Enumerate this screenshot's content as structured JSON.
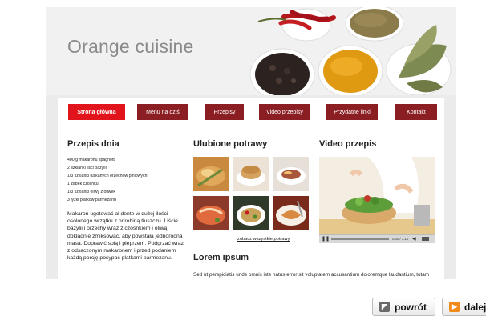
{
  "site": {
    "brand": "Orange cuisine",
    "nav": [
      "Strona główna",
      "Menu na dziś",
      "Przepisy",
      "Video przepisy",
      "Przydatne linki",
      "Kontakt"
    ]
  },
  "recipe": {
    "title": "Przepis dnia",
    "ingredients": [
      "400 g makaronu spaghetti",
      "2 szklanki liści bazylii",
      "1/3 szklanki łuskanych orzechów piniowych",
      "1 ząbek czosnku",
      "1/3 szklanki oliwy z oliwek",
      "3 łyżki płatków parmezanu"
    ],
    "description": "Makaron ugotować al dente w dużej ilości osolonego wrzątku z odrobiną tłuszczu. Liście bazylii i orzechy wraz z czosnkiem i oliwą dokładnie zmiksować, aby powstała jednorodna masa. Doprawić solą i pieprzem. Podgrzać wraz z odsączonym makaronem i przed podaniem każdą porcję posypać płatkami parmezanu."
  },
  "favorites": {
    "title": "Ulubione potrawy",
    "link": "zobacz wszystkie potrawy"
  },
  "video": {
    "title": "Video przepis",
    "time": "0:00 / 3:10"
  },
  "lorem": {
    "title": "Lorem ipsum",
    "text": "Sed ut perspiciatis unde omnis iste natus error sit voluptatem accusantium doloremque laudantium, totam rem aperiaperspiciatis unde omnis iste natus error sit voluptatem accusantium doloremque"
  },
  "pager": {
    "back": "powrót",
    "next": "dalej"
  },
  "colors": {
    "nav_active": "#e1131b",
    "nav": "#8b1e22",
    "next_icon": "#f28a1a",
    "back_icon": "#6a6a6a"
  }
}
